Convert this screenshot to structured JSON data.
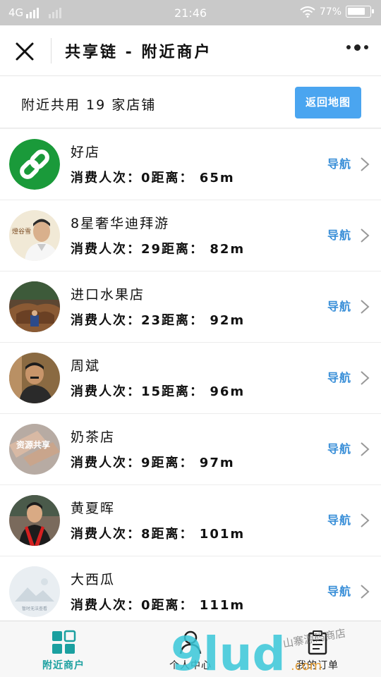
{
  "status_bar": {
    "network": "4G",
    "time": "21:46",
    "battery": "77%"
  },
  "title_bar": {
    "title": "共享链 - 附近商户"
  },
  "summary": {
    "text": "附近共用 19 家店铺",
    "map_button": "返回地图"
  },
  "stores": [
    {
      "name": "好店",
      "stats": "消费人次：0距离：  65m",
      "nav": "导航",
      "avatar": "link-icon"
    },
    {
      "name": "8星奢华迪拜游",
      "stats": "消费人次：29距离：  82m",
      "nav": "导航",
      "avatar": "photo"
    },
    {
      "name": "进口水果店",
      "stats": "消费人次：23距离：  92m",
      "nav": "导航",
      "avatar": "photo"
    },
    {
      "name": "周斌",
      "stats": "消费人次：15距离：  96m",
      "nav": "导航",
      "avatar": "photo"
    },
    {
      "name": "奶茶店",
      "stats": "消费人次：9距离：  97m",
      "nav": "导航",
      "avatar": "photo"
    },
    {
      "name": "黄夏晖",
      "stats": "消费人次：8距离：  101m",
      "nav": "导航",
      "avatar": "photo"
    },
    {
      "name": "大西瓜",
      "stats": "消费人次：0距离：  111m",
      "nav": "导航",
      "avatar": "placeholder"
    }
  ],
  "avatar_texts": {
    "second": "燈谷雪",
    "fifth": "资源共享",
    "placeholder": "暂时无法查看"
  },
  "tabs": [
    {
      "label": "附近商户",
      "icon": "grid-icon",
      "active": true
    },
    {
      "label": "个人中心",
      "icon": "person-icon",
      "active": false
    },
    {
      "label": "我的订单",
      "icon": "clipboard-icon",
      "active": false
    }
  ],
  "watermark": {
    "logo": "9lud",
    "suffix": ".com",
    "tagline": "山寨源码商店"
  },
  "colors": {
    "accent_blue": "#4aa5f0",
    "link_blue": "#3a8fd8",
    "active_tab": "#1ba0a0",
    "green_icon": "#1a9a3a"
  }
}
